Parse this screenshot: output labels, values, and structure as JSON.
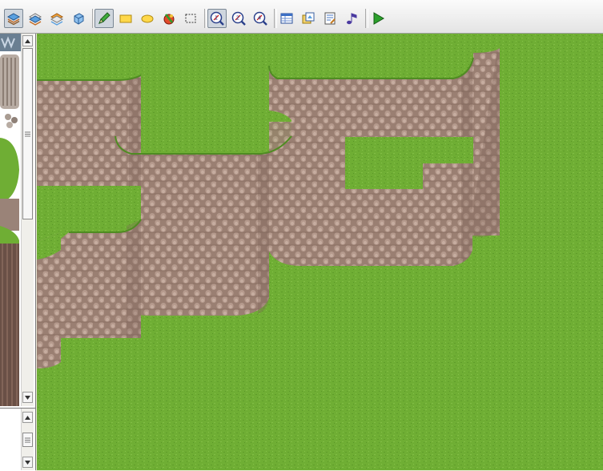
{
  "window": {
    "title": ""
  },
  "toolbar": {
    "groups": [
      {
        "name": "layers",
        "items": [
          "layer-1-icon",
          "layer-2-icon",
          "layer-3-icon",
          "event-layer-icon"
        ]
      },
      {
        "name": "drawing",
        "items": [
          "pencil-icon",
          "rectangle-icon",
          "ellipse-icon",
          "fill-icon",
          "select-icon"
        ]
      },
      {
        "name": "zoom",
        "items": [
          "zoom-1-1-icon",
          "zoom-1-2-icon",
          "zoom-1-4-icon"
        ]
      },
      {
        "name": "tools",
        "items": [
          "database-icon",
          "resource-manager-icon",
          "script-editor-icon",
          "sound-test-icon"
        ]
      },
      {
        "name": "play",
        "items": [
          "play-icon"
        ]
      }
    ],
    "pressed": [
      "layer-1-icon",
      "pencil-icon",
      "zoom-1-1-icon"
    ]
  },
  "colors": {
    "grass": "#6fae34",
    "grass_dark": "#5a9628",
    "cliff": "#a4877a",
    "cliff_dark": "#7d6458",
    "accent_play": "#2ca02c"
  }
}
